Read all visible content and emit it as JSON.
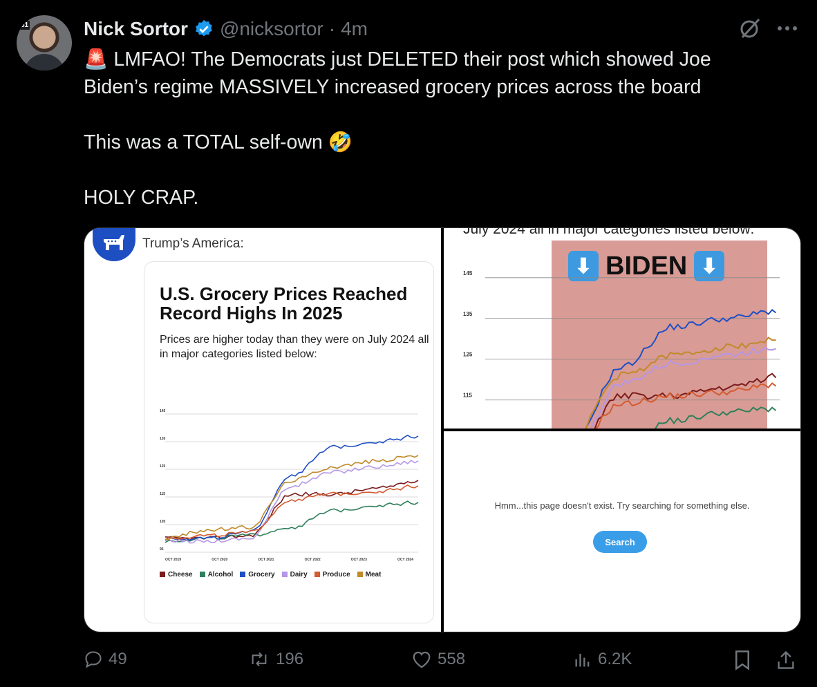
{
  "post": {
    "author_name": "Nick Sortor",
    "handle": "@nicksortor",
    "separator": "·",
    "time": "4m",
    "text_lines": [
      "🚨 LMFAO! The Democrats just DELETED their post which showed Joe",
      "Biden’s regime MASSIVELY increased grocery prices across the board",
      "",
      "This was a TOTAL self-own 🤣",
      "",
      "HOLY CRAP."
    ]
  },
  "media": {
    "left": {
      "account": "Trump’s America:",
      "title": "U.S. Grocery Prices Reached Record Highs In 2025",
      "subtitle": "Prices are higher today than they were on July 2024 all in major categories listed below:"
    },
    "top_right": {
      "caption": "July 2024 all in major categories listed below:",
      "banner": "BIDEN",
      "arrow": "⬇"
    },
    "bottom_right": {
      "message": "Hmm...this page doesn't exist. Try searching for something else.",
      "button": "Search"
    }
  },
  "chart_data": {
    "type": "line",
    "title": "U.S. Grocery Prices Reached Record Highs In 2025",
    "ylim": [
      95,
      145
    ],
    "yticks": [
      "145",
      "135",
      "125",
      "115",
      "105",
      "95"
    ],
    "x": [
      "OCT 2019",
      "OCT 2020",
      "OCT 2021",
      "OCT 2022",
      "OCT 2023",
      "OCT 2024"
    ],
    "series": [
      {
        "name": "Cheese",
        "color": "#7b1b1b",
        "values": [
          100,
          100,
          101,
          116,
          116,
          118,
          121
        ]
      },
      {
        "name": "Alcohol",
        "color": "#2e7f5a",
        "values": [
          99,
          100,
          101,
          104,
          110,
          112,
          113
        ]
      },
      {
        "name": "Grocery",
        "color": "#1f4fc6",
        "values": [
          100,
          100,
          102,
          123,
          133,
          135,
          137
        ]
      },
      {
        "name": "Dairy",
        "color": "#b497e6",
        "values": [
          99,
          99,
          100,
          119,
          124,
          126,
          128
        ]
      },
      {
        "name": "Produce",
        "color": "#d35b2f",
        "values": [
          100,
          101,
          102,
          114,
          116,
          117,
          119
        ]
      },
      {
        "name": "Meat",
        "color": "#c08a2a",
        "values": [
          100,
          103,
          104,
          121,
          126,
          128,
          130
        ]
      }
    ]
  },
  "actions": {
    "replies": "49",
    "reposts": "196",
    "likes": "558",
    "views": "6.2K"
  }
}
